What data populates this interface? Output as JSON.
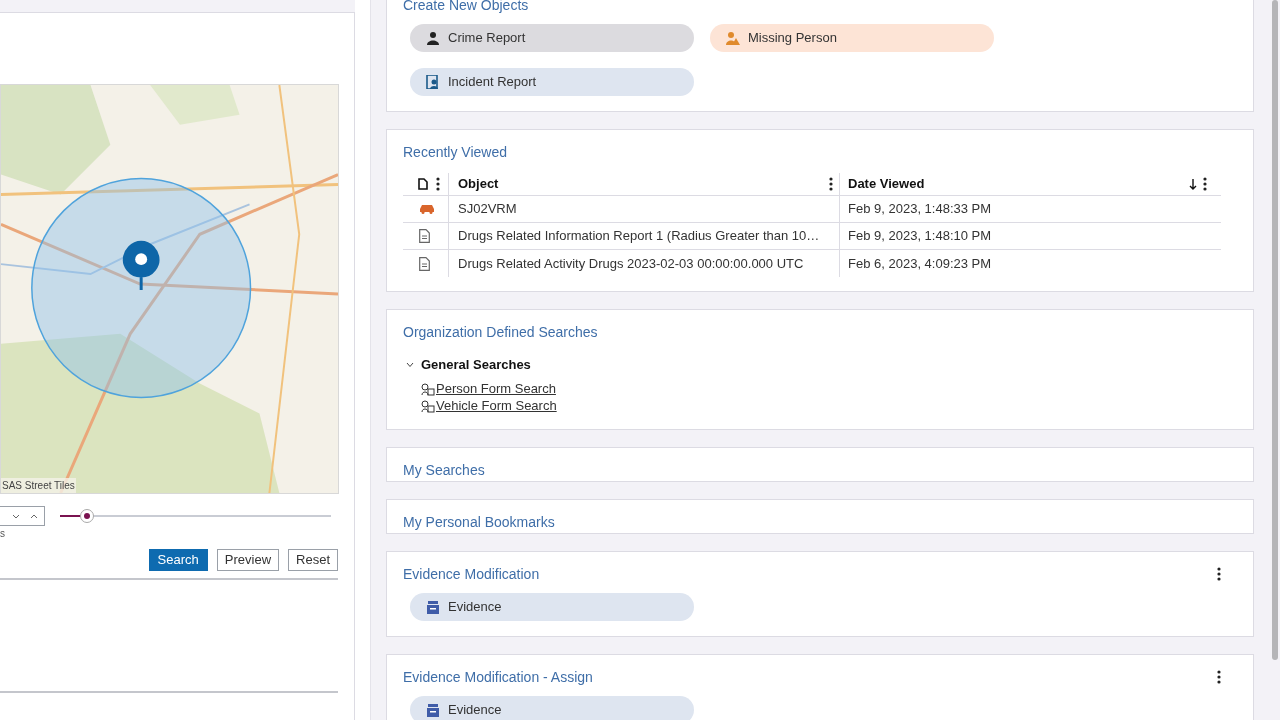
{
  "left_panel": {
    "map_attribution": "SAS Street Tiles",
    "stepper_hint": "s",
    "slider": {
      "level": 0.1
    },
    "buttons": [
      {
        "label": "Search",
        "primary": true
      },
      {
        "label": "Preview",
        "primary": false
      },
      {
        "label": "Reset",
        "primary": false
      }
    ]
  },
  "create_new_objects": {
    "title": "Create New Objects",
    "items": [
      {
        "label": "Crime Report",
        "kind": "crime",
        "color": "#dcdbdf"
      },
      {
        "label": "Missing Person",
        "kind": "missing",
        "color": "#fde4d6"
      },
      {
        "label": "Incident Report",
        "kind": "incident",
        "color": "#dee5f0"
      }
    ]
  },
  "recently_viewed": {
    "title": "Recently Viewed",
    "columns": [
      "Object",
      "Date Viewed"
    ],
    "rows": [
      {
        "kind": "vehicle",
        "object": "SJ02VRM",
        "date": "Feb 9, 2023, 1:48:33 PM"
      },
      {
        "kind": "document",
        "object": "Drugs Related Information Report 1 (Radius Greater than 10…",
        "date": "Feb 9, 2023, 1:48:10 PM"
      },
      {
        "kind": "document",
        "object": "Drugs Related Activity Drugs 2023-02-03 00:00:00.000 UTC",
        "date": "Feb 6, 2023, 4:09:23 PM"
      }
    ]
  },
  "organization_defined_searches": {
    "title": "Organization Defined Searches",
    "groups": [
      {
        "label": "General Searches",
        "expanded": true,
        "children": [
          {
            "label": "Person Form Search"
          },
          {
            "label": "Vehicle Form Search"
          }
        ]
      }
    ]
  },
  "my_searches": {
    "title": "My Searches"
  },
  "my_personal_bookmarks": {
    "title": "My Personal Bookmarks"
  },
  "evidence_modification": {
    "title": "Evidence Modification",
    "items": [
      {
        "label": "Evidence",
        "kind": "evidence",
        "color": "#dee5f0"
      }
    ]
  },
  "evidence_modification_assign": {
    "title": "Evidence Modification - Assign",
    "items": [
      {
        "label": "Evidence",
        "kind": "evidence",
        "color": "#dee5f0"
      }
    ]
  }
}
